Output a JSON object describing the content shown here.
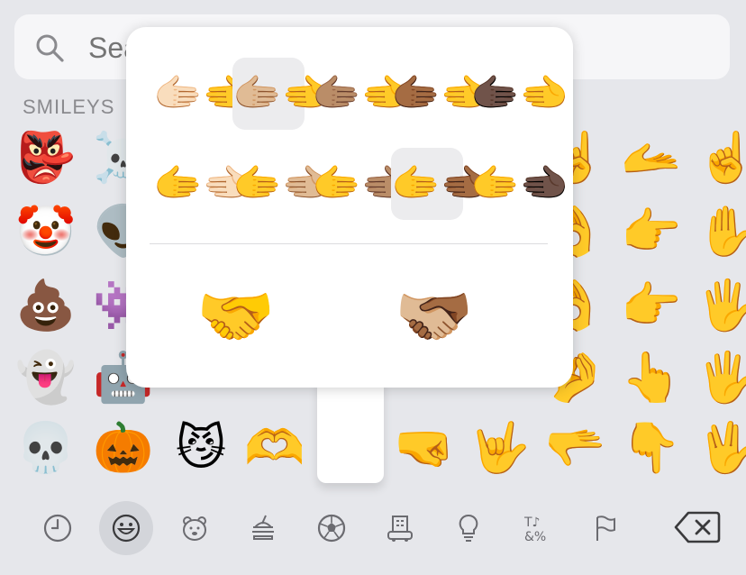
{
  "search": {
    "placeholder": "Search Emoji"
  },
  "section": {
    "title": "SMILEYS"
  },
  "grid": [
    [
      "👺",
      "☠️",
      "",
      "",
      "",
      "",
      "",
      "☝️",
      "🫴",
      "☝️"
    ],
    [
      "🤡",
      "👽",
      "",
      "",
      "",
      "",
      "",
      "👌",
      "👉",
      "✋"
    ],
    [
      "💩",
      "👾",
      "",
      "",
      "",
      "",
      "",
      "👌",
      "👉",
      "🖐️"
    ],
    [
      "👻",
      "🤖",
      "",
      "",
      "",
      "",
      "",
      "🤌",
      "👆",
      "🖐️"
    ],
    [
      "💀",
      "🎃",
      "😼",
      "🫶",
      "",
      "🤜",
      "🤟",
      "🫳",
      "👇",
      "🖖"
    ]
  ],
  "popup": {
    "row1": [
      "🫱🏻‍🫲",
      "🫱🏼‍🫲",
      "🫱🏽‍🫲",
      "🫱🏾‍🫲",
      "🫱🏿‍🫲"
    ],
    "row2": [
      "🫱‍🫲🏻",
      "🫱‍🫲🏼",
      "🫱‍🫲🏽",
      "🫱‍🫲🏾",
      "🫱‍🫲🏿"
    ],
    "selected_row1_index": 1,
    "selected_row2_index": 3,
    "default_emoji": "🤝",
    "combined_emoji": "🫱🏼‍🫲🏾"
  },
  "bottom_bar": {
    "categories": [
      {
        "name": "recent",
        "icon": "clock-icon"
      },
      {
        "name": "smileys",
        "icon": "smiley-icon",
        "active": true
      },
      {
        "name": "animals",
        "icon": "bear-icon"
      },
      {
        "name": "food",
        "icon": "food-icon"
      },
      {
        "name": "activity",
        "icon": "ball-icon"
      },
      {
        "name": "travel",
        "icon": "building-icon"
      },
      {
        "name": "objects",
        "icon": "lightbulb-icon"
      },
      {
        "name": "symbols",
        "icon": "symbols-icon"
      },
      {
        "name": "flags",
        "icon": "flag-icon"
      }
    ],
    "symbols_glyph": "T♪\n&%"
  }
}
